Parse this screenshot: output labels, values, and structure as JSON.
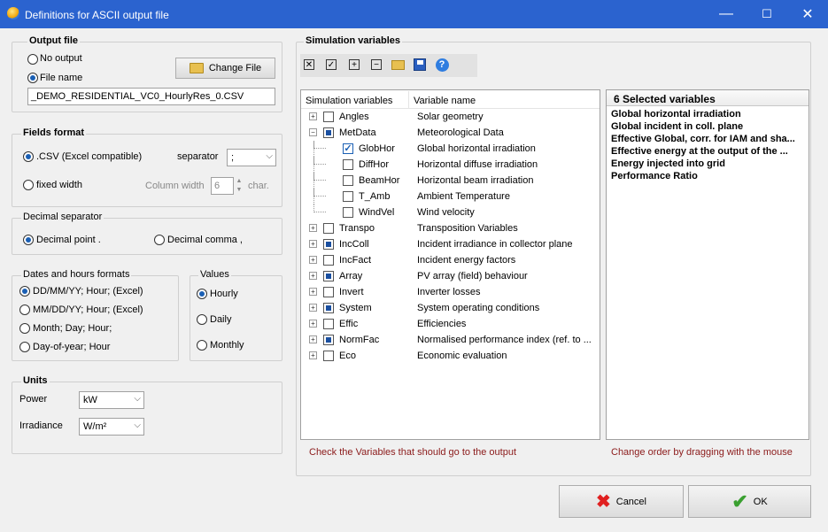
{
  "window": {
    "title": "Definitions for ASCII output file",
    "minimize": "—",
    "maximize": "☐",
    "close": "✕"
  },
  "output_file": {
    "legend": "Output file",
    "no_output": "No output",
    "file_name": "File name",
    "change_file": "Change File",
    "file_value": "_DEMO_RESIDENTIAL_VC0_HourlyRes_0.CSV"
  },
  "fields_format": {
    "legend": "Fields format",
    "csv": ".CSV (Excel compatible)",
    "separator_label": "separator",
    "separator_value": ";",
    "fixed_width": "fixed width",
    "column_width_label": "Column width",
    "column_width_value": "6",
    "char_label": "char."
  },
  "decimal": {
    "legend": "Decimal separator",
    "point": "Decimal point .",
    "comma": "Decimal comma ,"
  },
  "dates": {
    "legend": "Dates and hours formats",
    "options": [
      "DD/MM/YY; Hour;  (Excel)",
      "MM/DD/YY; Hour;  (Excel)",
      "Month; Day; Hour;",
      "Day-of-year; Hour"
    ]
  },
  "values": {
    "legend": "Values",
    "options": [
      "Hourly",
      "Daily",
      "Monthly"
    ]
  },
  "units": {
    "legend": "Units",
    "power_label": "Power",
    "power_value": "kW",
    "irradiance_label": "Irradiance",
    "irradiance_value": "W/m²"
  },
  "sim": {
    "legend": "Simulation variables",
    "col1": "Simulation variables",
    "col2": "Variable name",
    "hint_left": "Check the Variables that should go to the output",
    "hint_right": "Change order by dragging with the mouse",
    "rows": [
      {
        "code": "Angles",
        "name": "Solar geometry",
        "level": 0,
        "state": "none",
        "expander": "+"
      },
      {
        "code": "MetData",
        "name": "Meteorological Data",
        "level": 0,
        "state": "partial",
        "expander": "−"
      },
      {
        "code": "GlobHor",
        "name": "Global horizontal irradiation",
        "level": 1,
        "state": "checked",
        "expander": ""
      },
      {
        "code": "DiffHor",
        "name": "Horizontal diffuse irradiation",
        "level": 1,
        "state": "none",
        "expander": ""
      },
      {
        "code": "BeamHor",
        "name": "Horizontal beam irradiation",
        "level": 1,
        "state": "none",
        "expander": ""
      },
      {
        "code": "T_Amb",
        "name": "Ambient Temperature",
        "level": 1,
        "state": "none",
        "expander": ""
      },
      {
        "code": "WindVel",
        "name": "Wind velocity",
        "level": 1,
        "state": "none",
        "expander": ""
      },
      {
        "code": "Transpo",
        "name": "Transposition Variables",
        "level": 0,
        "state": "none",
        "expander": "+"
      },
      {
        "code": "IncColl",
        "name": "Incident irradiance in collector plane",
        "level": 0,
        "state": "partial",
        "expander": "+"
      },
      {
        "code": "IncFact",
        "name": "Incident energy factors",
        "level": 0,
        "state": "none",
        "expander": "+"
      },
      {
        "code": "Array",
        "name": "PV array (field) behaviour",
        "level": 0,
        "state": "partial",
        "expander": "+"
      },
      {
        "code": "Invert",
        "name": "Inverter losses",
        "level": 0,
        "state": "none",
        "expander": "+"
      },
      {
        "code": "System",
        "name": "System operating conditions",
        "level": 0,
        "state": "partial",
        "expander": "+"
      },
      {
        "code": "Effic",
        "name": "Efficiencies",
        "level": 0,
        "state": "none",
        "expander": "+"
      },
      {
        "code": "NormFac",
        "name": "Normalised performance index (ref. to ...",
        "level": 0,
        "state": "partial",
        "expander": "+"
      },
      {
        "code": "Eco",
        "name": "Economic evaluation",
        "level": 0,
        "state": "none",
        "expander": "+"
      }
    ]
  },
  "selected": {
    "header": "6 Selected variables",
    "items": [
      "Global horizontal irradiation",
      "Global incident in coll. plane",
      "Effective Global, corr. for IAM and sha...",
      "Effective energy at the output of the ...",
      "Energy injected into grid",
      "Performance Ratio"
    ]
  },
  "buttons": {
    "cancel": "Cancel",
    "ok": "OK"
  },
  "colors": {
    "titlebar": "#2b63cf",
    "accent": "#1a5fb4",
    "hint": "#8b1a1a"
  }
}
